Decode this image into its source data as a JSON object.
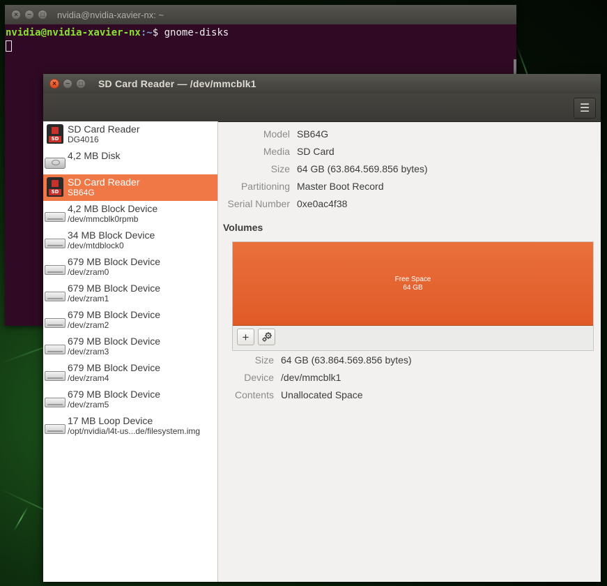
{
  "terminal": {
    "title": "nvidia@nvidia-xavier-nx: ~",
    "prompt_user": "nvidia@nvidia-xavier-nx",
    "prompt_path": ":~",
    "prompt_symbol": "$",
    "command": " gnome-disks"
  },
  "disks": {
    "title": "SD Card Reader — /dev/mmcblk1",
    "menu_icon": "hamburger-menu-icon",
    "devices": [
      {
        "name": "SD Card Reader",
        "sub": "DG4016",
        "icon": "sd-card-icon",
        "selected": false
      },
      {
        "name": "4,2 MB Disk",
        "sub": "",
        "icon": "harddisk-icon",
        "selected": false
      },
      {
        "name": "SD Card Reader",
        "sub": "SB64G",
        "icon": "sd-card-icon",
        "selected": true
      },
      {
        "name": "4,2 MB Block Device",
        "sub": "/dev/mmcblk0rpmb",
        "icon": "drive-icon",
        "selected": false
      },
      {
        "name": "34 MB Block Device",
        "sub": "/dev/mtdblock0",
        "icon": "drive-icon",
        "selected": false
      },
      {
        "name": "679 MB Block Device",
        "sub": "/dev/zram0",
        "icon": "drive-icon",
        "selected": false
      },
      {
        "name": "679 MB Block Device",
        "sub": "/dev/zram1",
        "icon": "drive-icon",
        "selected": false
      },
      {
        "name": "679 MB Block Device",
        "sub": "/dev/zram2",
        "icon": "drive-icon",
        "selected": false
      },
      {
        "name": "679 MB Block Device",
        "sub": "/dev/zram3",
        "icon": "drive-icon",
        "selected": false
      },
      {
        "name": "679 MB Block Device",
        "sub": "/dev/zram4",
        "icon": "drive-icon",
        "selected": false
      },
      {
        "name": "679 MB Block Device",
        "sub": "/dev/zram5",
        "icon": "drive-icon",
        "selected": false
      },
      {
        "name": "17 MB Loop Device",
        "sub": "/opt/nvidia/l4t-us...de/filesystem.img",
        "icon": "drive-icon",
        "selected": false
      }
    ],
    "drive_info": {
      "model_label": "Model",
      "model": "SB64G",
      "media_label": "Media",
      "media": "SD Card",
      "size_label": "Size",
      "size": "64 GB (63.864.569.856 bytes)",
      "partitioning_label": "Partitioning",
      "partitioning": "Master Boot Record",
      "serial_label": "Serial Number",
      "serial": "0xe0ac4f38"
    },
    "volumes_heading": "Volumes",
    "volume_bar": {
      "label": "Free Space",
      "size": "64 GB"
    },
    "add_button": "+",
    "settings_icon": "gears-icon",
    "volume_info": {
      "size_label": "Size",
      "size": "64 GB (63.864.569.856 bytes)",
      "device_label": "Device",
      "device": "/dev/mmcblk1",
      "contents_label": "Contents",
      "contents": "Unallocated Space"
    },
    "accent_color": "#f07746"
  }
}
